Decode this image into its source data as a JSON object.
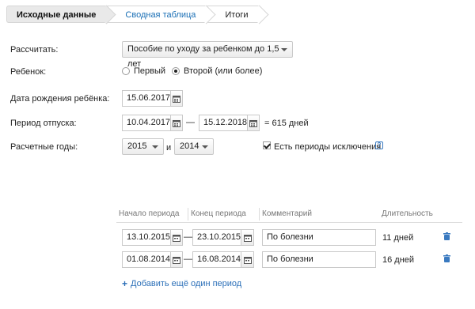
{
  "steps": [
    {
      "label": "Исходные данные"
    },
    {
      "label": "Сводная таблица"
    },
    {
      "label": "Итоги"
    }
  ],
  "form": {
    "calc_label": "Рассчитать:",
    "calc_value": "Пособие по уходу за ребенком до 1,5 лет",
    "child_label": "Ребенок:",
    "child_options": [
      "Первый",
      "Второй (или более)"
    ],
    "child_selected": "Второй (или более)",
    "birth_label": "Дата рождения ребёнка:",
    "birth_date": "15.06.2017",
    "leave_label": "Период отпуска:",
    "leave_from": "10.04.2017",
    "leave_dash": "—",
    "leave_to": "15.12.2018",
    "leave_days": "= 615 дней",
    "years_label": "Расчетные годы:",
    "year1": "2015",
    "years_and": "и",
    "year2": "2014",
    "exclusions_label": "Есть периоды исключения",
    "exclusions_checked": true
  },
  "table": {
    "headers": [
      "Начало периода",
      "Конец периода",
      "Комментарий",
      "Длительность"
    ],
    "rows": [
      {
        "start": "13.10.2015",
        "dash": "—",
        "end": "23.10.2015",
        "comment": "По болезни",
        "duration": "11 дней"
      },
      {
        "start": "01.08.2014",
        "dash": "—",
        "end": "16.08.2014",
        "comment": "По болезни",
        "duration": "16 дней"
      }
    ],
    "add_link": "Добавить ещё один период"
  },
  "colors": {
    "link": "#2b6fb8",
    "trash": "#3a7ac0"
  }
}
